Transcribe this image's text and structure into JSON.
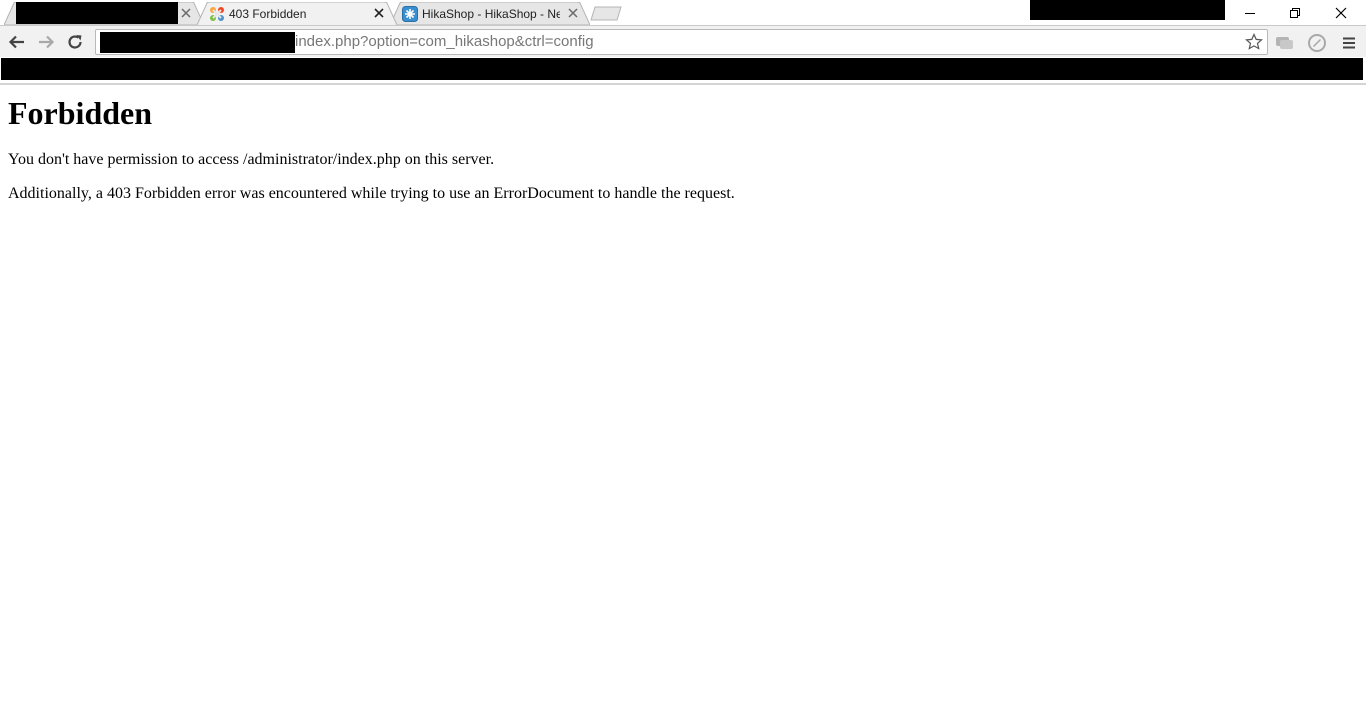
{
  "browser": {
    "tabs": [
      {
        "title": "",
        "redacted": true,
        "active": false
      },
      {
        "title": "403 Forbidden",
        "favicon": "joomla-icon",
        "active": true
      },
      {
        "title": "HikaShop - HikaShop - Ne",
        "favicon": "hikashop-icon",
        "active": false
      }
    ],
    "address_bar": {
      "url_visible": "index.php?option=com_hikashop&ctrl=config"
    },
    "icons": {
      "back": "back-arrow-icon",
      "forward": "forward-arrow-icon",
      "reload": "reload-icon",
      "bookmark": "star-icon",
      "extension1": "chat-bubble-icon",
      "extension2": "compass-icon",
      "menu": "hamburger-menu-icon",
      "minimize": "minimize-icon",
      "restore": "restore-icon",
      "close": "close-icon"
    }
  },
  "page": {
    "heading": "Forbidden",
    "paragraph1": "You don't have permission to access /administrator/index.php on this server.",
    "paragraph2": "Additionally, a 403 Forbidden error was encountered while trying to use an ErrorDocument to handle the request."
  },
  "colors": {
    "toolbar_bg": "#f1f1f1",
    "tab_inactive_bg": "#e6e6e6",
    "redaction": "#000000"
  }
}
